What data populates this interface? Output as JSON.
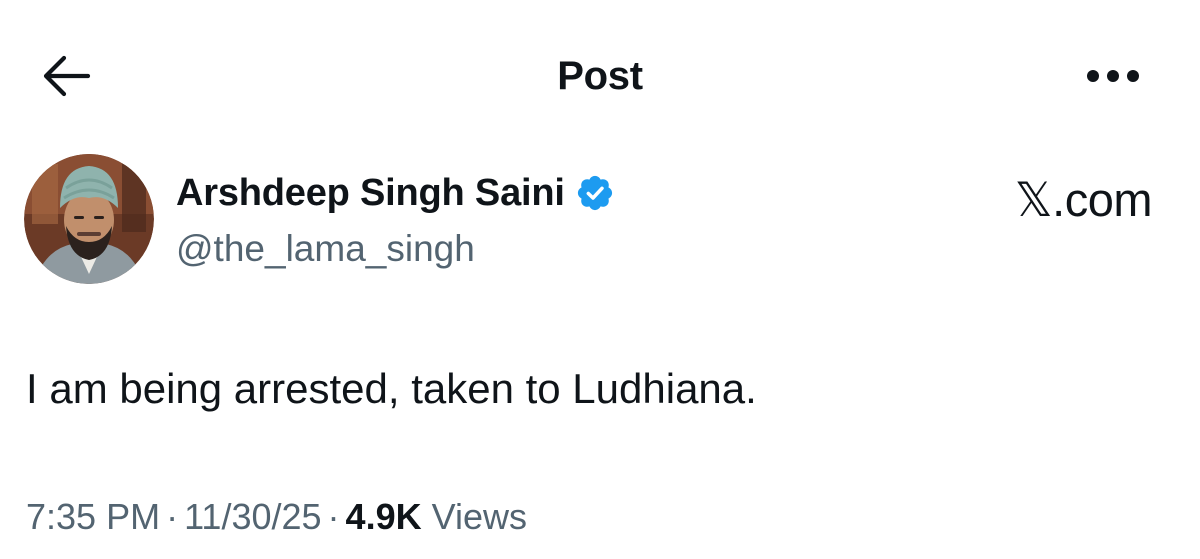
{
  "header": {
    "title": "Post",
    "back_icon": "arrow-left-icon",
    "more_icon": "more-horizontal-icon"
  },
  "author": {
    "display_name": "Arshdeep Singh Saini",
    "handle": "@the_lama_singh",
    "verified": true,
    "verified_color": "#1d9bf0"
  },
  "watermark": "𝕏.com",
  "post": {
    "text": "I am being arrested, taken to Ludhiana."
  },
  "meta": {
    "time": "7:35 PM",
    "separator": "·",
    "date": "11/30/25",
    "views_count": "4.9K",
    "views_label": "Views"
  },
  "colors": {
    "text_primary": "#0f1419",
    "text_secondary": "#536471",
    "accent": "#1d9bf0",
    "background": "#ffffff"
  }
}
